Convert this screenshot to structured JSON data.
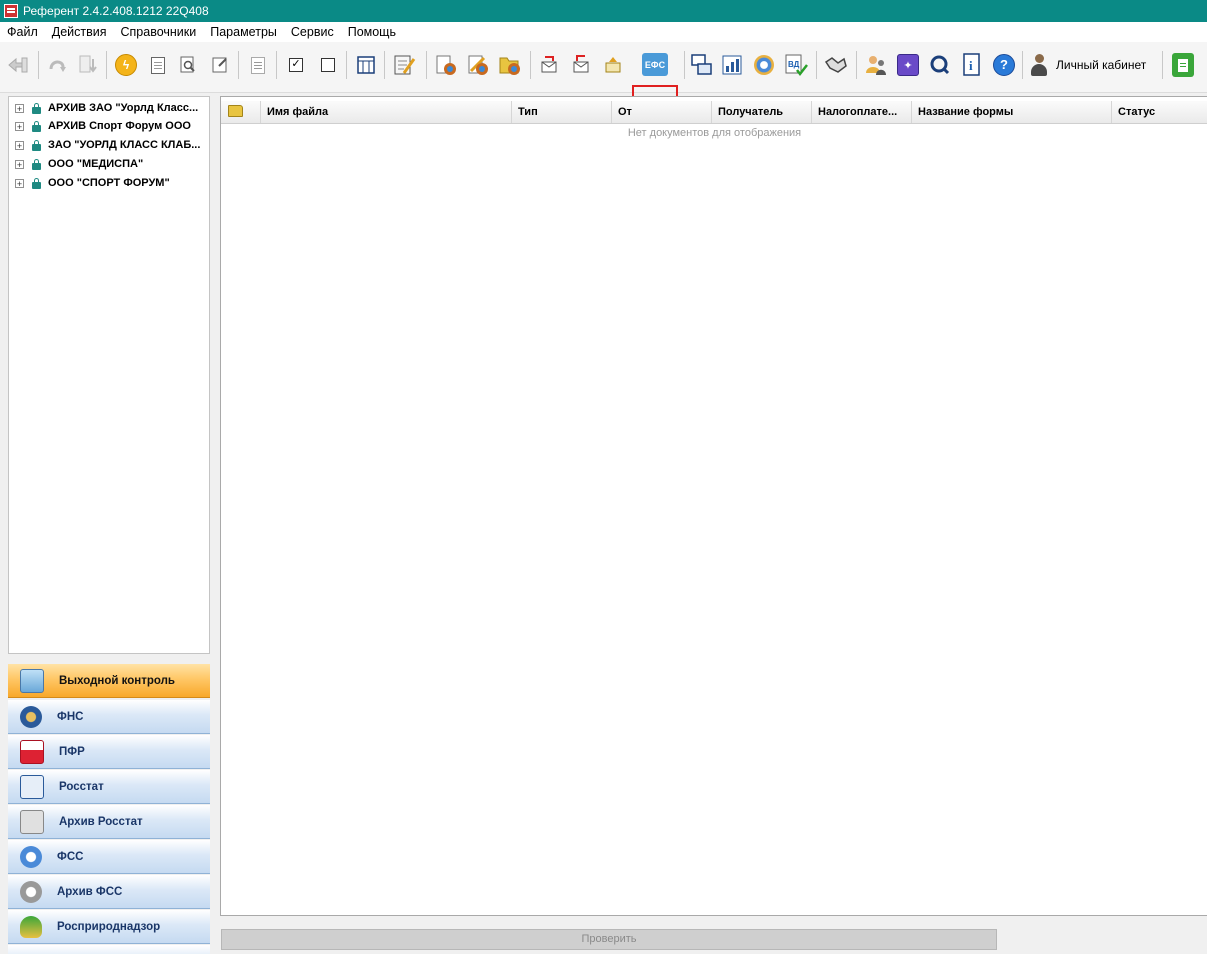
{
  "window": {
    "title": "Референт 2.4.2.408.1212 22Q408"
  },
  "menu": [
    "Файл",
    "Действия",
    "Справочники",
    "Параметры",
    "Сервис",
    "Помощь"
  ],
  "toolbar": {
    "efs_label": "ЕФС",
    "cabinet_label": "Личный кабинет"
  },
  "tree": {
    "items": [
      "АРХИВ ЗАО \"Уорлд Класс...",
      "АРХИВ Спорт Форум ООО",
      "ЗАО \"УОРЛД КЛАСС КЛАБ...",
      "ООО \"МЕДИСПА\"",
      "ООО \"СПОРТ ФОРУМ\""
    ]
  },
  "nav": {
    "items": [
      "Выходной контроль",
      "ФНС",
      "ПФР",
      "Росстат",
      "Архив Росстат",
      "ФСС",
      "Архив ФСС",
      "Росприроднадзор"
    ]
  },
  "grid": {
    "columns": [
      "Имя файла",
      "Тип",
      "От",
      "Получатель",
      "Налогоплате...",
      "Название формы",
      "Статус"
    ],
    "empty_text": "Нет документов для отображения"
  },
  "actions": {
    "check_label": "Проверить"
  }
}
